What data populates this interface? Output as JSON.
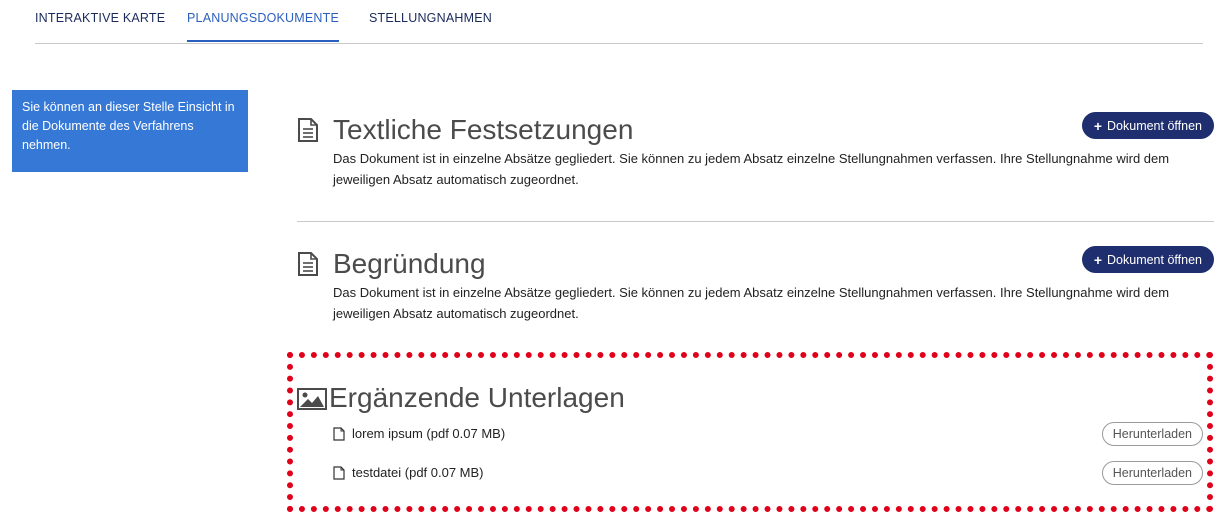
{
  "tabs": [
    {
      "label": "INTERAKTIVE KARTE",
      "active": false
    },
    {
      "label": "PLANUNGSDOKUMENTE",
      "active": true
    },
    {
      "label": "STELLUNGNAHMEN",
      "active": false
    }
  ],
  "info_box": {
    "text": "Sie können an dieser Stelle Einsicht in die Dokumente des Verfahrens nehmen."
  },
  "documents": [
    {
      "title": "Textliche Festsetzungen",
      "button_label": "Dokument öffnen",
      "description": "Das Dokument ist in einzelne Absätze gegliedert. Sie können zu jedem Absatz einzelne Stellungnahmen verfassen. Ihre Stellungnahme wird dem jeweiligen Absatz automatisch zugeordnet."
    },
    {
      "title": "Begründung",
      "button_label": "Dokument öffnen",
      "description": "Das Dokument ist in einzelne Absätze gegliedert. Sie können zu jedem Absatz einzelne Stellungnahmen verfassen. Ihre Stellungnahme wird dem jeweiligen Absatz automatisch zugeordnet."
    }
  ],
  "supplementary": {
    "title": "Ergänzende Unterlagen",
    "files": [
      {
        "name": "lorem ipsum (pdf 0.07 MB)",
        "button_label": "Herunterladen"
      },
      {
        "name": "testdatei (pdf 0.07 MB)",
        "button_label": "Herunterladen"
      }
    ]
  },
  "colors": {
    "accent": "#2b5fbf",
    "info_box": "#3578d6",
    "primary_button": "#1f2e6e",
    "highlight_border": "#e0001a"
  },
  "icons": {
    "document": "document-icon",
    "image": "image-icon",
    "file": "file-icon",
    "plus": "plus-icon"
  }
}
